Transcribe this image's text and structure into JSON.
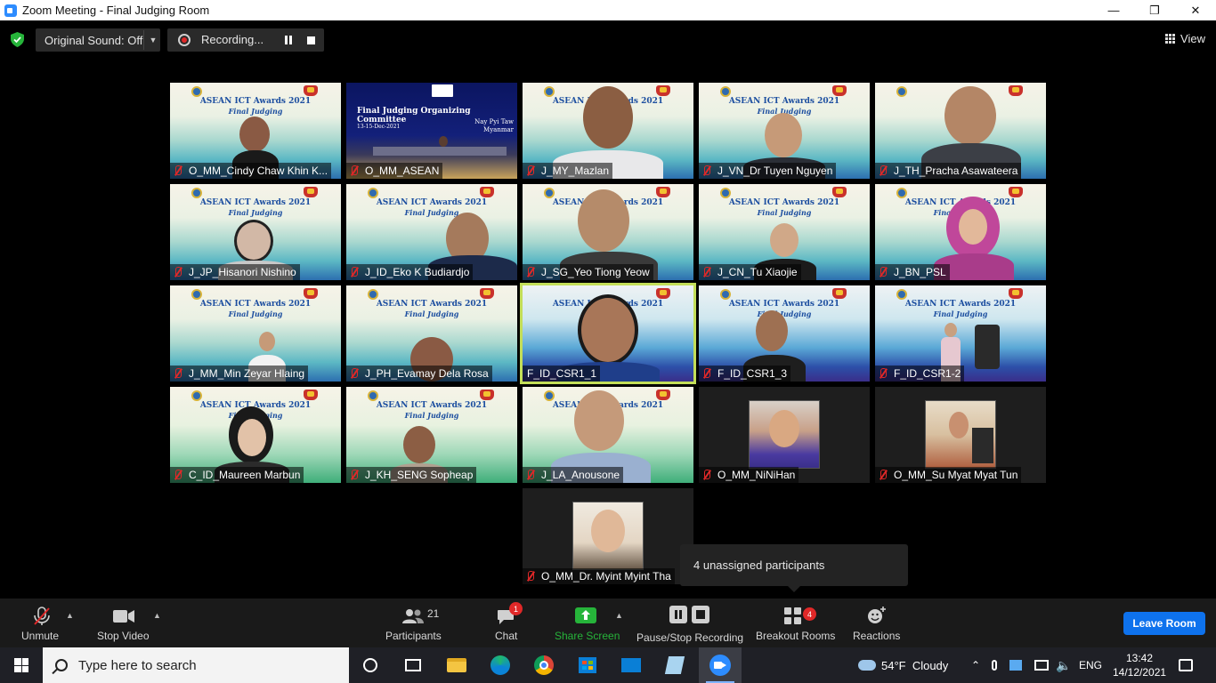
{
  "window": {
    "title": "Zoom Meeting - Final Judging Room",
    "controls": [
      "minimize",
      "restore",
      "close"
    ]
  },
  "top_bar": {
    "original_sound": "Original Sound: Off",
    "recording": "Recording...",
    "view": "View"
  },
  "background": {
    "event_title": "ASEAN ICT Awards 2021",
    "event_subtitle": "Final Judging",
    "committee_title": "Final Judging Organizing Committee",
    "committee_location": "Nay Pyi Taw\nMyanmar",
    "committee_date": "13-15-Dec-2021"
  },
  "participants": [
    {
      "name": "O_MM_Cindy Chaw Khin K...",
      "muted": true
    },
    {
      "name": "O_MM_ASEAN",
      "muted": true
    },
    {
      "name": "J_MY_Mazlan",
      "muted": true
    },
    {
      "name": "J_VN_Dr Tuyen Nguyen",
      "muted": true
    },
    {
      "name": "J_TH_Pracha Asawateera",
      "muted": true
    },
    {
      "name": "J_JP_Hisanori Nishino",
      "muted": true
    },
    {
      "name": "J_ID_Eko K Budiardjo",
      "muted": true
    },
    {
      "name": "J_SG_Yeo Tiong Yeow",
      "muted": true
    },
    {
      "name": "J_CN_Tu Xiaojie",
      "muted": true
    },
    {
      "name": "J_BN_PSL",
      "muted": true
    },
    {
      "name": "J_MM_Min Zeyar Hlaing",
      "muted": true
    },
    {
      "name": "J_PH_Evamay Dela Rosa",
      "muted": true
    },
    {
      "name": "F_ID_CSR1_1",
      "muted": false,
      "speaking": true
    },
    {
      "name": "F_ID_CSR1_3",
      "muted": true
    },
    {
      "name": "F_ID_CSR1-2",
      "muted": true
    },
    {
      "name": "C_ID_Maureen Marbun",
      "muted": true
    },
    {
      "name": "J_KH_SENG Sopheap",
      "muted": true
    },
    {
      "name": "J_LA_Anousone",
      "muted": true
    },
    {
      "name": "O_MM_NiNiHan",
      "muted": true
    },
    {
      "name": "O_MM_Su Myat Myat Tun",
      "muted": true
    },
    {
      "name": "O_MM_Dr. Myint Myint Tha",
      "muted": true
    }
  ],
  "tooltip": "4 unassigned participants",
  "toolbar": {
    "unmute": "Unmute",
    "stop_video": "Stop Video",
    "participants": "Participants",
    "participants_count": "21",
    "chat": "Chat",
    "chat_badge": "1",
    "share_screen": "Share Screen",
    "pause_stop_recording": "Pause/Stop Recording",
    "breakout_rooms": "Breakout Rooms",
    "breakout_badge": "4",
    "reactions": "Reactions",
    "leave_room": "Leave Room"
  },
  "taskbar": {
    "search_placeholder": "Type here to search",
    "weather": "54°F  Cloudy",
    "language": "ENG",
    "time": "13:42",
    "date": "14/12/2021",
    "pinned_apps": [
      "cortana-icon",
      "task-view-icon",
      "file-explorer-icon",
      "edge-icon",
      "chrome-icon",
      "store-icon",
      "mail-icon",
      "notepad-icon",
      "zoom-icon"
    ]
  },
  "colors": {
    "speaking_border": "#c3de58",
    "muted_red": "#e02828",
    "share_green": "#26b43a",
    "leave_blue": "#0e72ed",
    "badge_red": "#e02828"
  }
}
